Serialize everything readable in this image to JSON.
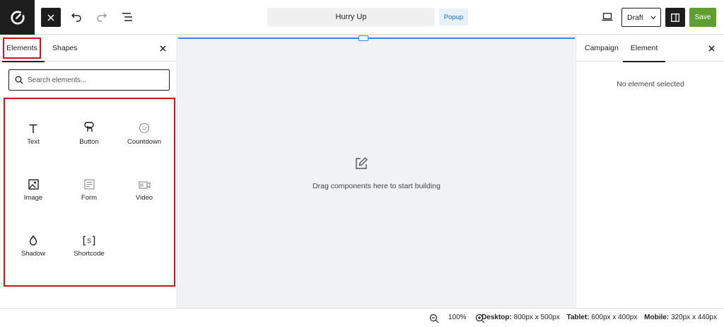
{
  "toolbar": {
    "title": "Hurry Up",
    "popup_badge": "Popup",
    "status": "Draft",
    "save_label": "Save",
    "icons": [
      "logo",
      "close-icon",
      "undo-icon",
      "redo-icon",
      "list-view-icon",
      "laptop-icon",
      "chevron-down-icon",
      "sidebar-toggle-icon"
    ]
  },
  "left_panel": {
    "tabs": [
      {
        "label": "Elements",
        "active": true
      },
      {
        "label": "Shapes",
        "active": false
      }
    ],
    "search_placeholder": "Search elements...",
    "elements": [
      {
        "label": "Text",
        "icon": "text-icon"
      },
      {
        "label": "Button",
        "icon": "button-icon"
      },
      {
        "label": "Countdown",
        "icon": "countdown-icon"
      },
      {
        "label": "Image",
        "icon": "image-icon"
      },
      {
        "label": "Form",
        "icon": "form-icon"
      },
      {
        "label": "Video",
        "icon": "video-icon"
      },
      {
        "label": "Shadow",
        "icon": "shadow-icon"
      },
      {
        "label": "Shortcode",
        "icon": "shortcode-icon"
      }
    ],
    "highlight_color": "#d0121b"
  },
  "canvas": {
    "empty_text": "Drag components here to start building",
    "accent": "#3b82f6"
  },
  "right_panel": {
    "tabs": [
      {
        "label": "Campaign",
        "active": false
      },
      {
        "label": "Element",
        "active": true
      }
    ],
    "empty_text": "No element selected"
  },
  "footer": {
    "zoom": "100%",
    "sizes": [
      {
        "label": "Desktop:",
        "value": "800px x 500px"
      },
      {
        "label": "Tablet:",
        "value": "600px x 400px"
      },
      {
        "label": "Mobile:",
        "value": "320px x 440px"
      }
    ]
  },
  "colors": {
    "save": "#5f9e33",
    "dark": "#1e1e1e",
    "popup_bg": "#e8f0fb",
    "popup_text": "#2271b1"
  }
}
